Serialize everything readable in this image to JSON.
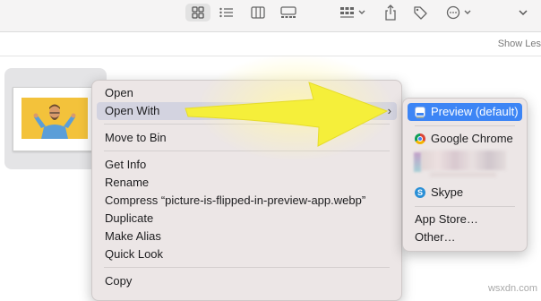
{
  "toolbar": {
    "icons": [
      "icon-view-icon",
      "list-view-icon",
      "column-view-icon",
      "gallery-view-icon",
      "group-icon",
      "share-icon",
      "tag-icon",
      "more-icon",
      "chevron-down-icon"
    ]
  },
  "pathbar": {
    "show_less": "Show Les"
  },
  "context_menu": {
    "items": [
      {
        "label": "Open"
      },
      {
        "label": "Open With",
        "has_submenu": true
      },
      {
        "label": "Move to Bin"
      },
      {
        "label": "Get Info"
      },
      {
        "label": "Rename"
      },
      {
        "label": "Compress “picture-is-flipped-in-preview-app.webp”"
      },
      {
        "label": "Duplicate"
      },
      {
        "label": "Make Alias"
      },
      {
        "label": "Quick Look"
      },
      {
        "label": "Copy"
      }
    ],
    "submenu_chevron": "›"
  },
  "open_with_submenu": {
    "items": [
      {
        "label": "Preview (default)",
        "icon": "preview-icon",
        "active": true
      },
      {
        "label": "Google Chrome",
        "icon": "chrome-icon"
      },
      {
        "label": "Skype",
        "icon": "skype-icon"
      },
      {
        "label": "App Store…"
      },
      {
        "label": "Other…"
      }
    ]
  },
  "colors": {
    "highlight": "#3d85f5",
    "arrow": "#f5ef3a",
    "thumb_bg": "#f3c23b"
  },
  "watermark": "wsxdn.com"
}
